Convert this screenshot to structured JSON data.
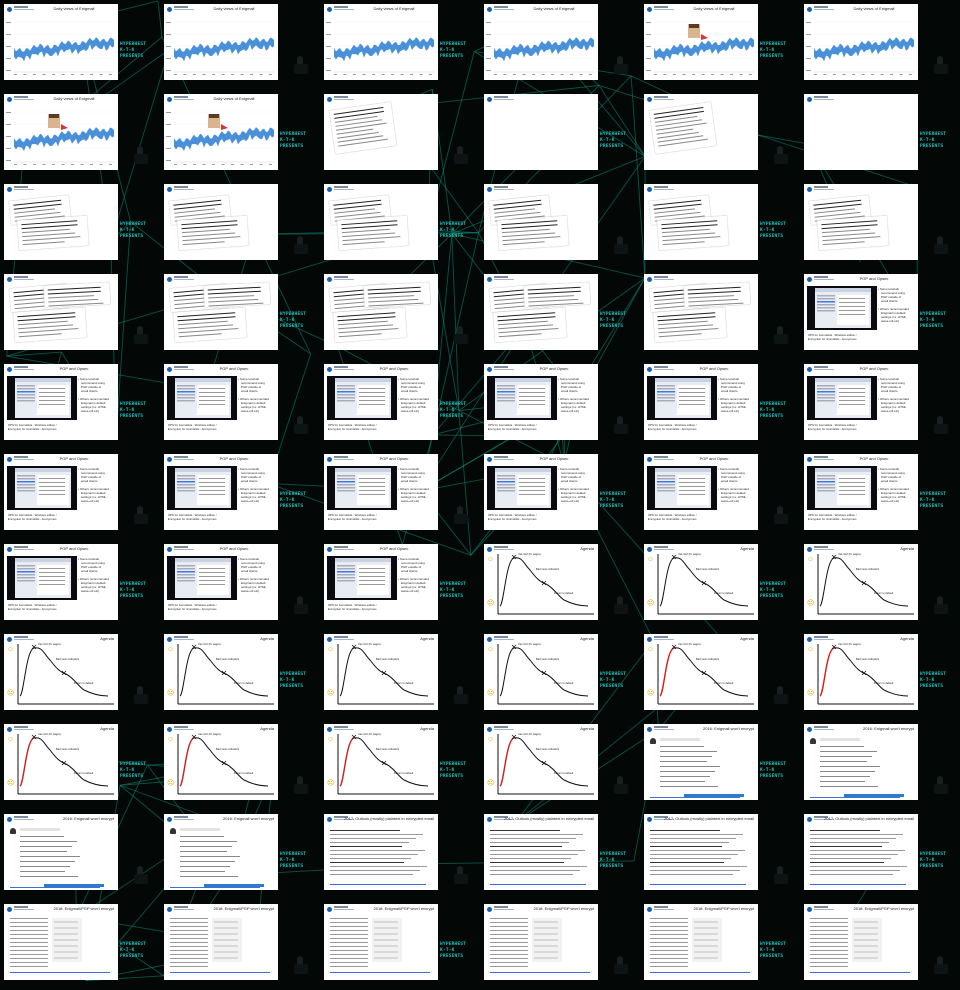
{
  "venue_logo_lines": [
    "HYPERHEST",
    "K-T-K",
    "PRESENTS"
  ],
  "slide_titles": {
    "daily_views": "Daily views of Enigmail",
    "pgp_options": "PGP and Opsec",
    "agenda": "Agenda",
    "won_t_encrypt": "2016: Enigmail won't encrypt",
    "outlook_plaintext": "2017: Outlook (mostly) plaintext in encrypted email",
    "enigmail_pgp_won_t_encrypt": "2018: Enigmail/PGP won't encrypt"
  },
  "rows": [
    [
      "daily",
      "daily",
      "daily",
      "daily",
      "daily_face",
      "daily"
    ],
    [
      "daily_face",
      "daily_face",
      "paper1",
      "blank",
      "paper1",
      "blank"
    ],
    [
      "paper2",
      "paper2",
      "paper2",
      "paper2",
      "paper2",
      "paper2"
    ],
    [
      "paper3",
      "paper3",
      "paper3",
      "paper3",
      "paper3",
      "pgp"
    ],
    [
      "pgp",
      "pgp",
      "pgp",
      "pgp",
      "pgp",
      "pgp"
    ],
    [
      "pgp",
      "pgp",
      "pgp",
      "pgp",
      "pgp",
      "pgp"
    ],
    [
      "pgp",
      "pgp",
      "pgp",
      "agenda",
      "agenda",
      "agenda"
    ],
    [
      "agenda",
      "agenda",
      "agenda",
      "agenda",
      "agenda_red",
      "agenda_red"
    ],
    [
      "agenda_red",
      "agenda_red",
      "agenda_red",
      "agenda_red",
      "wont",
      "wont"
    ],
    [
      "wont",
      "wont",
      "outlook",
      "outlook",
      "outlook",
      "outlook"
    ],
    [
      "enig",
      "enig",
      "enig",
      "enig",
      "enig",
      "enig"
    ]
  ],
  "agenda_labels": {
    "peak": "Use GUI (fix pages)",
    "mid": "Bad news indicators",
    "low": "Return to default"
  },
  "pgp_bullets": [
    "Some tutorials",
    "recommend using",
    "PGP outside of",
    "email clients",
    "Others recommended",
    "Enigmail in default",
    "settings (i.e. HTML,",
    "swiss-roll etc)"
  ],
  "pgp_caption": [
    "OPS for Journalists - Windows edition /",
    "Encryption for Journalists - Anonymous"
  ],
  "colors": {
    "background": "#030807",
    "network_lines": "#0f8f7a",
    "chart_fill": "#4a90d9",
    "venue_logo": "#19c6c0",
    "link_blue": "#2b7bd0"
  }
}
